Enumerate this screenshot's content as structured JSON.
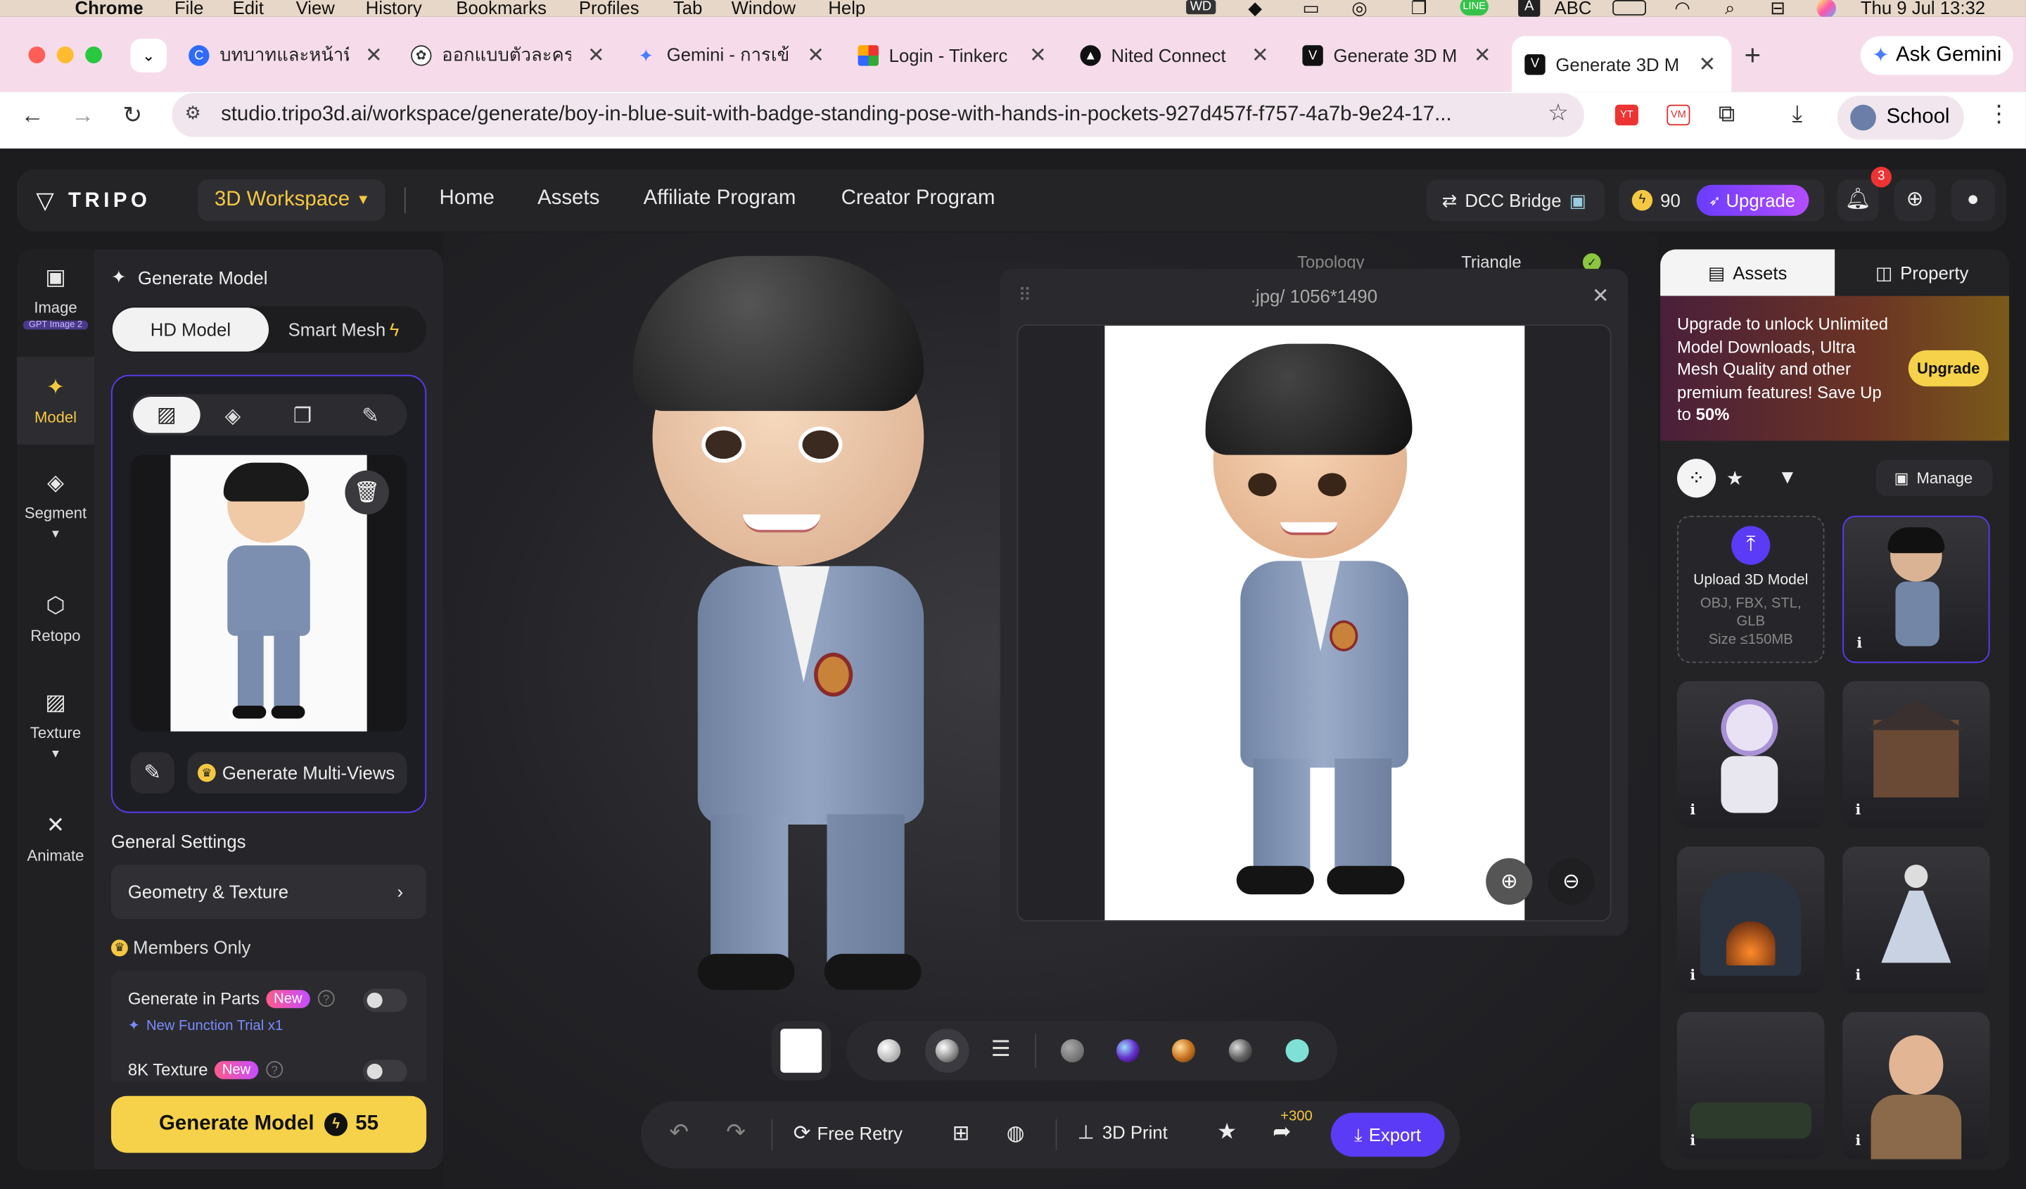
{
  "menubar": {
    "app": "Chrome",
    "items": [
      "File",
      "Edit",
      "View",
      "History",
      "Bookmarks",
      "Profiles",
      "Tab",
      "Window",
      "Help"
    ],
    "input_source": "ABC",
    "input_letter": "A",
    "clock": "Thu 9 Jul  13:32"
  },
  "tabs": [
    {
      "title": "บทบาทและหน้าที่ข",
      "icon": "c-icon"
    },
    {
      "title": "ออกแบบตัวละคร",
      "icon": "openai-icon"
    },
    {
      "title": "Gemini - การเข้า",
      "icon": "gemini-icon"
    },
    {
      "title": "Login - Tinkerc",
      "icon": "tinkercad-icon"
    },
    {
      "title": "Nited Connect",
      "icon": "nited-icon"
    },
    {
      "title": "Generate 3D M",
      "icon": "tripo-icon"
    },
    {
      "title": "Generate 3D M",
      "icon": "tripo-icon"
    }
  ],
  "ask_gemini": "Ask Gemini",
  "url": "studio.tripo3d.ai/workspace/generate/boy-in-blue-suit-with-badge-standing-pose-with-hands-in-pockets-927d457f-f757-4a7b-9e24-17...",
  "profile": "School",
  "app": {
    "brand": "TRIPO",
    "workspace": "3D Workspace",
    "nav": [
      "Home",
      "Assets",
      "Affiliate Program",
      "Creator Program"
    ],
    "dcc": "DCC Bridge",
    "credits": "90",
    "upgrade": "Upgrade",
    "notifications": "3"
  },
  "rail": [
    {
      "label": "Image",
      "sub": "GPT Image 2"
    },
    {
      "label": "Model"
    },
    {
      "label": "Segment"
    },
    {
      "label": "Retopo"
    },
    {
      "label": "Texture"
    },
    {
      "label": "Animate"
    }
  ],
  "panel": {
    "title": "Generate Model",
    "mode_hd": "HD Model",
    "mode_smart": "Smart Mesh",
    "multi_views": "Generate Multi-Views",
    "general_settings": "General Settings",
    "geometry_texture": "Geometry & Texture",
    "members_only": "Members Only",
    "parts": "Generate in Parts",
    "parts_new": "New",
    "trial": "New Function Trial x1",
    "texture8k": "8K Texture",
    "texture8k_new": "New",
    "generate": "Generate Model",
    "generate_cost": "55"
  },
  "viewer": {
    "topology_label": "Topology",
    "topology_value": "Triangle",
    "preview_title": ".jpg/ 1056*1490"
  },
  "toolbar": {
    "free_retry": "Free Retry",
    "print": "3D Print",
    "plus": "+300",
    "export": "Export"
  },
  "right": {
    "tab_assets": "Assets",
    "tab_property": "Property",
    "promo_text": "Upgrade to unlock Unlimited Model Downloads, Ultra Mesh Quality and other premium features!  Save Up to ",
    "promo_pct": "50%",
    "promo_btn": "Upgrade",
    "manage": "Manage",
    "upload_title": "Upload 3D Model",
    "upload_formats": "OBJ, FBX, STL, GLB",
    "upload_size": "Size ≤150MB"
  },
  "colors": {
    "accent": "#5b3bf5",
    "yellow": "#f5d24a",
    "pink_new": "#ff5a8a"
  }
}
